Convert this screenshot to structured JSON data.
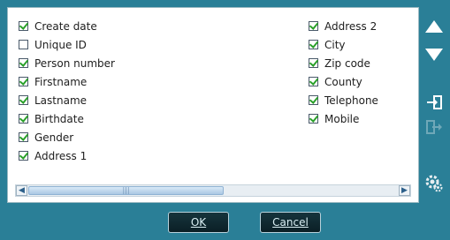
{
  "columns": {
    "left": [
      {
        "label": "Create date",
        "checked": true
      },
      {
        "label": "Unique ID",
        "checked": false
      },
      {
        "label": "Person number",
        "checked": true
      },
      {
        "label": "Firstname",
        "checked": true
      },
      {
        "label": "Lastname",
        "checked": true
      },
      {
        "label": "Birthdate",
        "checked": true
      },
      {
        "label": "Gender",
        "checked": true
      },
      {
        "label": "Address 1",
        "checked": true
      }
    ],
    "right": [
      {
        "label": "Address 2",
        "checked": true
      },
      {
        "label": "City",
        "checked": true
      },
      {
        "label": "Zip code",
        "checked": true
      },
      {
        "label": "County",
        "checked": true
      },
      {
        "label": "Telephone",
        "checked": true
      },
      {
        "label": "Mobile",
        "checked": true
      }
    ]
  },
  "buttons": {
    "ok": "OK",
    "cancel": "Cancel"
  },
  "icons": {
    "move_up": "triangle-up-icon",
    "move_down": "triangle-down-icon",
    "import": "import-icon",
    "export": "export-icon",
    "settings": "settings-gear-icon"
  },
  "colors": {
    "background": "#2a7f97",
    "check": "#2aa02a",
    "arrow": "#ffffff"
  }
}
